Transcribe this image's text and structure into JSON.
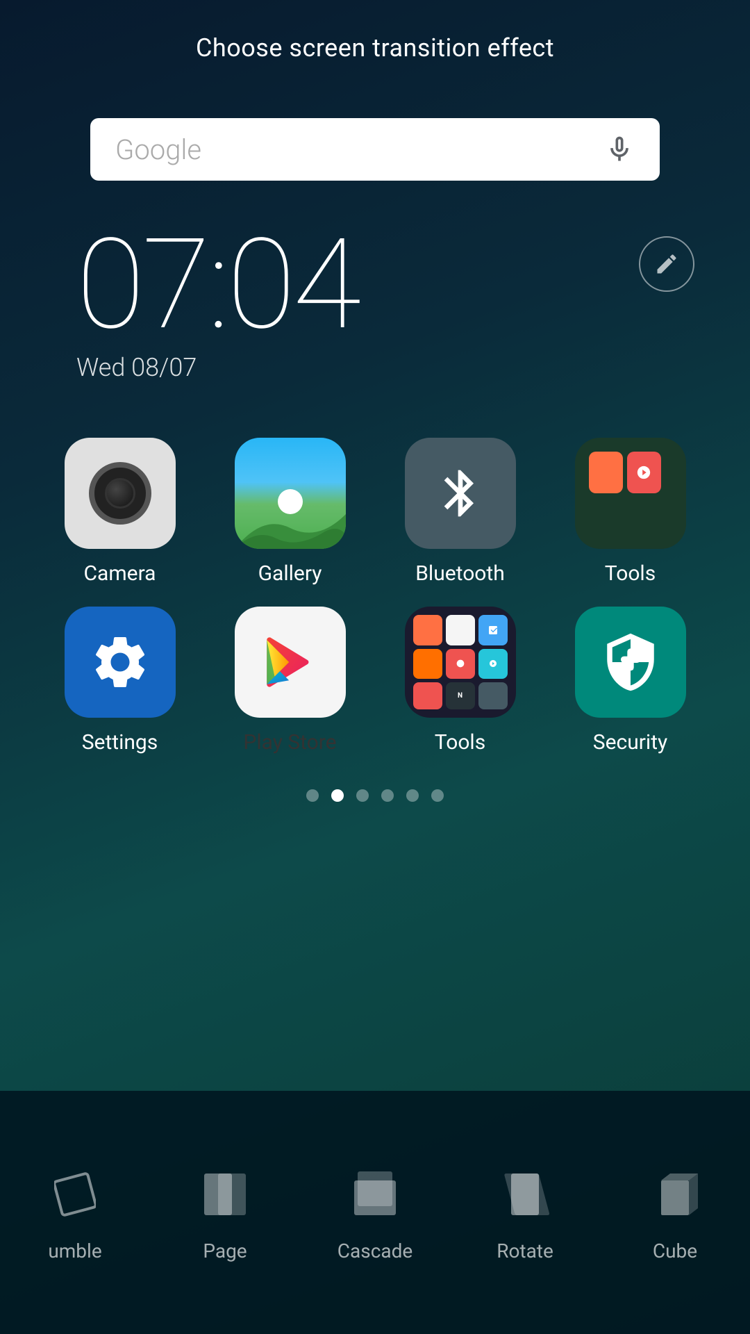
{
  "header": {
    "title": "Choose screen transition effect"
  },
  "search": {
    "placeholder": "Google",
    "mic_label": "mic"
  },
  "clock": {
    "time": "07:04",
    "date": "Wed 08/07"
  },
  "edit_button": {
    "label": "edit"
  },
  "apps": {
    "row1": [
      {
        "label": "Camera",
        "icon": "camera"
      },
      {
        "label": "Gallery",
        "icon": "gallery"
      },
      {
        "label": "Bluetooth",
        "icon": "bluetooth"
      },
      {
        "label": "Tools",
        "icon": "tools-folder"
      }
    ],
    "row2": [
      {
        "label": "Settings",
        "icon": "settings"
      },
      {
        "label": "Play Store",
        "icon": "playstore"
      },
      {
        "label": "Tools",
        "icon": "tools-apps"
      },
      {
        "label": "Security",
        "icon": "security"
      }
    ]
  },
  "page_indicators": {
    "total": 6,
    "active": 1
  },
  "transitions": [
    {
      "label": "umble",
      "icon": "transition-tumble"
    },
    {
      "label": "Page",
      "icon": "transition-page"
    },
    {
      "label": "Cascade",
      "icon": "transition-cascade"
    },
    {
      "label": "Rotate",
      "icon": "transition-rotate"
    },
    {
      "label": "Cube",
      "icon": "transition-cube"
    }
  ]
}
